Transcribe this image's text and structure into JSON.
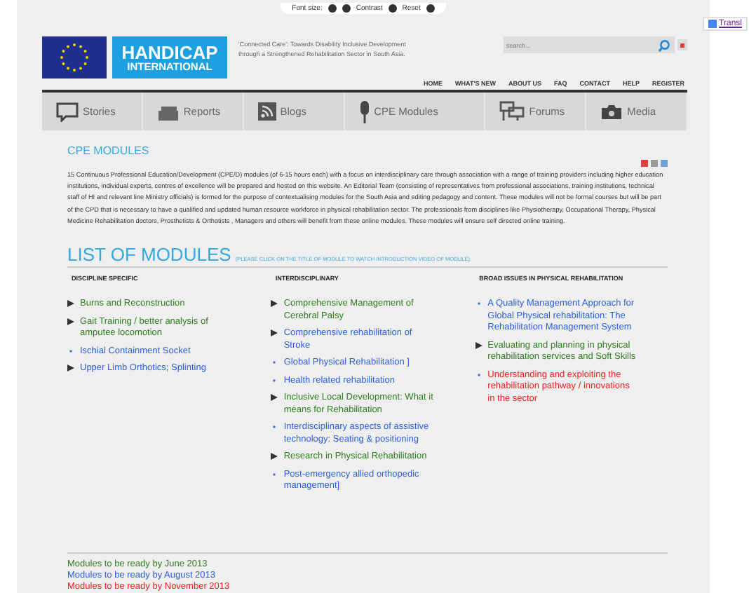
{
  "toolbar": {
    "font_size_label": "Font size:",
    "contrast_label": "Contrast",
    "reset_label": "Reset"
  },
  "translate_link": "Transl",
  "header": {
    "logo_top": "HANDICAP",
    "logo_bottom": "INTERNATIONAL",
    "tagline": "'Connected Care': Towards Disability Inclusive Development through a Strengthened Rehabilitation Sector in South Asia.",
    "search": {
      "placeholder": "search..."
    },
    "links": [
      "HOME",
      "WHAT'S NEW",
      "ABOUT US",
      "FAQ",
      "CONTACT",
      "HELP",
      "REGISTER"
    ]
  },
  "menu": [
    {
      "label": "Stories",
      "kind": "speech"
    },
    {
      "label": "Reports",
      "kind": "stack"
    },
    {
      "label": "Blogs",
      "kind": "rss"
    },
    {
      "label": "CPE Modules",
      "kind": "mic"
    },
    {
      "label": "Forums",
      "kind": "forum"
    },
    {
      "label": "Media",
      "kind": "camera"
    }
  ],
  "page_title": "CPE MODULES",
  "intro": "15 Continuous Professional Education/Development (CPE/D) modules (of 6-15 hours each) with a focus on interdisciplinary care through association with a range of training providers including higher education institutions, individual experts, centres of excellence will be prepared and hosted on this website. An Editorial Team (consisting of representatives from professional associations, training institutions, technical staff of HI and relevant line Ministry officials) is formed for the purpose of contextualising modules for the South Asia and editing pedagogy and content. These modules will not be formal courses but will be part of the CPD that is necessary to have a qualified and updated human resource workforce in physical rehabilitation sector. The professionals from disciplines like Physiotherapy, Occupational Therapy, Physical Medicine Rehabilitation doctors, Prosthetists & Orthotists , Managers and others will benefit from these online modules. These modules will ensure self directed online training.",
  "list_title": "LIST OF MODULES",
  "list_hint": "(PLEASE CLICK ON THE TITLE OF MODULE TO WATCH INTRODUCTION VIDEO OF MODULE)",
  "columns": [
    {
      "heading": "DISCIPLINE SPECIFIC",
      "items": [
        {
          "title": "Burns and Reconstruction",
          "kind": "arrow",
          "color": "#2e7d1e"
        },
        {
          "title": "Gait Training / better analysis of amputee locomotion",
          "kind": "arrow",
          "color": "#2e7d1e"
        },
        {
          "title": "Ischial Containment Socket",
          "kind": "dot",
          "color": "#2a5fe0"
        },
        {
          "title": "Upper Limb Orthotics; Splinting",
          "kind": "arrow",
          "color": "#2a5fe0"
        }
      ]
    },
    {
      "heading": "INTERDISCIPLINARY",
      "items": [
        {
          "title": "Comprehensive Management of Cerebral Palsy",
          "kind": "arrow",
          "color": "#2e7d1e"
        },
        {
          "title": "Comprehensive rehabilitation of Stroke",
          "kind": "arrow",
          "color": "#2a5fe0"
        },
        {
          "title": "Global Physical Rehabilitation ]",
          "kind": "dot",
          "color": "#2a5fe0"
        },
        {
          "title": "Health related rehabilitation",
          "kind": "dot",
          "color": "#2a5fe0"
        },
        {
          "title": "Inclusive Local Development: What it means for Rehabilitation",
          "kind": "arrow",
          "color": "#2e7d1e"
        },
        {
          "title": "Interdisciplinary aspects of assistive technology: Seating & positioning",
          "kind": "dot",
          "color": "#2a5fe0"
        },
        {
          "title": "Research in Physical Rehabilitation",
          "kind": "arrow",
          "color": "#2e7d1e"
        },
        {
          "title": "Post-emergency allied orthopedic management]",
          "kind": "dot",
          "color": "#2a5fe0"
        }
      ]
    },
    {
      "heading": "BROAD ISSUES IN PHYSICAL REHABILITATION",
      "items": [
        {
          "title": "A Quality Management Approach for Global Physical rehabilitation: The Rehabilitation Management System",
          "kind": "dot",
          "color": "#2a5fe0"
        },
        {
          "title": "Evaluating and planning in physical rehabilitation services and Soft Skills",
          "kind": "arrow",
          "color": "#2e7d1e"
        },
        {
          "title": "Understanding and exploiting the rehabilitation pathway / innovations in the sector",
          "kind": "dot",
          "color": "#f02020"
        }
      ]
    }
  ],
  "legend": [
    {
      "label": "Modules to be ready by June 2013",
      "color": "#2e7d1e"
    },
    {
      "label": "Modules to be ready by August 2013",
      "color": "#2a5fe0"
    },
    {
      "label": "Modules to be ready by November 2013",
      "color": "#f02020"
    }
  ]
}
